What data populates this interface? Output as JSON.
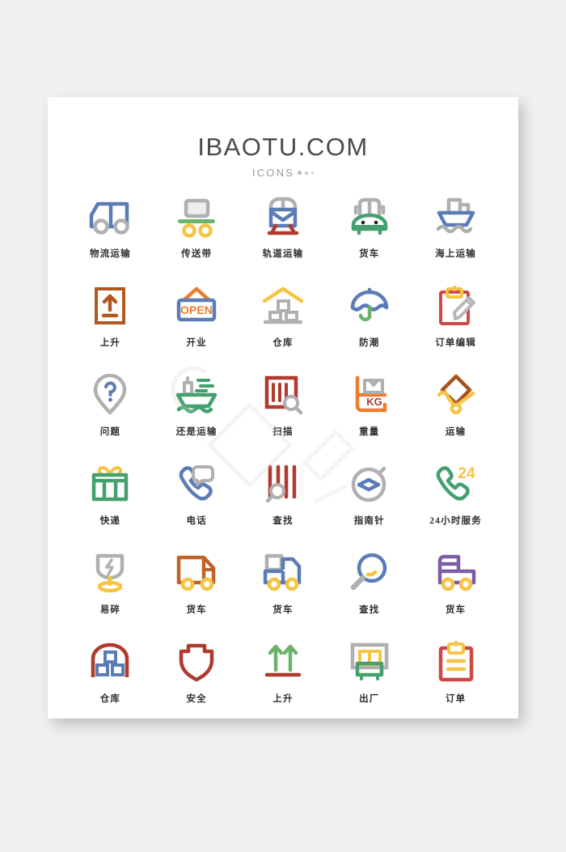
{
  "page": {
    "background_color": "#f0f0f0",
    "card_color": "#ffffff"
  },
  "header": {
    "title": "IBAOTU.COM",
    "subtitle": "ICONS"
  },
  "palette": {
    "blue": "#5b7cb5",
    "gray": "#b0b0b0",
    "green": "#45a06f",
    "yellow": "#f5c council",
    "amber": "#f6c445",
    "orange": "#ef7b2f",
    "red": "#c0392b",
    "crimson": "#d0474a",
    "brown": "#a8521f",
    "purple": "#7b5ea7",
    "dark_red": "#b03a2e"
  },
  "icons": [
    {
      "label": "物流运输",
      "name": "logistics-truck-icon",
      "row": 1,
      "col": 1
    },
    {
      "label": "传送带",
      "name": "conveyor-belt-icon",
      "row": 1,
      "col": 2
    },
    {
      "label": "轨道运输",
      "name": "rail-transport-icon",
      "row": 1,
      "col": 3
    },
    {
      "label": "货车",
      "name": "truck-front-icon",
      "row": 1,
      "col": 4
    },
    {
      "label": "海上运输",
      "name": "sea-transport-ship-icon",
      "row": 1,
      "col": 5
    },
    {
      "label": "上升",
      "name": "this-way-up-icon",
      "row": 2,
      "col": 1
    },
    {
      "label": "开业",
      "name": "open-sign-icon",
      "row": 2,
      "col": 2,
      "sign_text": "OPEN"
    },
    {
      "label": "仓库",
      "name": "warehouse-icon",
      "row": 2,
      "col": 3
    },
    {
      "label": "防潮",
      "name": "keep-dry-umbrella-icon",
      "row": 2,
      "col": 4
    },
    {
      "label": "订单编辑",
      "name": "order-edit-icon",
      "row": 2,
      "col": 5
    },
    {
      "label": "问题",
      "name": "question-pin-icon",
      "row": 3,
      "col": 1
    },
    {
      "label": "还是运输",
      "name": "cargo-ship-icon",
      "row": 3,
      "col": 2
    },
    {
      "label": "扫描",
      "name": "barcode-scan-icon",
      "row": 3,
      "col": 3
    },
    {
      "label": "重量",
      "name": "weight-scale-icon",
      "row": 3,
      "col": 4,
      "badge_text": "KG"
    },
    {
      "label": "运输",
      "name": "handcart-transport-icon",
      "row": 3,
      "col": 5
    },
    {
      "label": "快递",
      "name": "gift-parcel-icon",
      "row": 4,
      "col": 1
    },
    {
      "label": "电话",
      "name": "phone-support-icon",
      "row": 4,
      "col": 2
    },
    {
      "label": "查找",
      "name": "barcode-search-icon",
      "row": 4,
      "col": 3
    },
    {
      "label": "指南针",
      "name": "compass-icon",
      "row": 4,
      "col": 4
    },
    {
      "label": "24小时服务",
      "name": "24h-service-icon",
      "row": 4,
      "col": 5,
      "badge_text": "24"
    },
    {
      "label": "易碎",
      "name": "fragile-icon",
      "row": 5,
      "col": 1
    },
    {
      "label": "货车",
      "name": "box-truck-icon",
      "row": 5,
      "col": 2
    },
    {
      "label": "货车",
      "name": "delivery-truck-icon",
      "row": 5,
      "col": 3
    },
    {
      "label": "查找",
      "name": "magnifier-icon",
      "row": 5,
      "col": 4
    },
    {
      "label": "货车",
      "name": "flatbed-truck-icon",
      "row": 5,
      "col": 5
    },
    {
      "label": "仓库",
      "name": "barn-storage-icon",
      "row": 6,
      "col": 1
    },
    {
      "label": "安全",
      "name": "safety-shield-icon",
      "row": 6,
      "col": 2
    },
    {
      "label": "上升",
      "name": "arrows-up-icon",
      "row": 6,
      "col": 3
    },
    {
      "label": "出厂",
      "name": "factory-output-icon",
      "row": 6,
      "col": 4
    },
    {
      "label": "订单",
      "name": "order-clipboard-icon",
      "row": 6,
      "col": 5
    }
  ]
}
